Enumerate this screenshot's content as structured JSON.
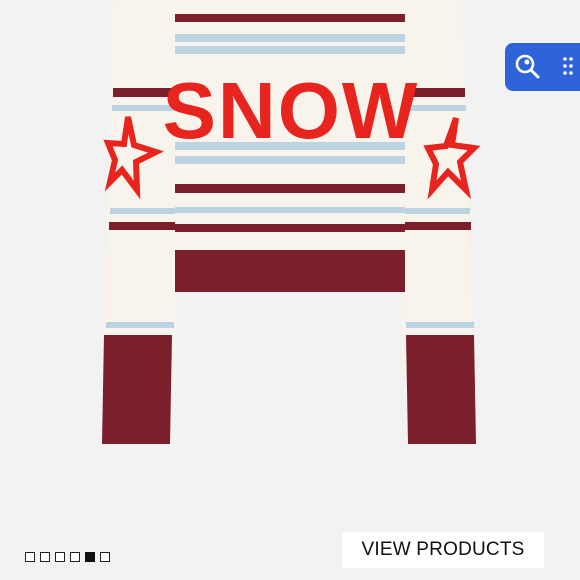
{
  "product": {
    "sweater_text": "SNOW",
    "colors": {
      "background": "#f2f2f2",
      "knit_base": "#f8f4ec",
      "burgundy": "#7a1f2b",
      "light_blue": "#bcd3e3",
      "red": "#e8241e"
    }
  },
  "lens_button": {
    "icon": "visual-search-icon",
    "secondary_icon": "dots-grid-icon",
    "color": "#2f63d9"
  },
  "carousel": {
    "total": 6,
    "active_index": 4
  },
  "cta": {
    "label": "VIEW PRODUCTS"
  }
}
